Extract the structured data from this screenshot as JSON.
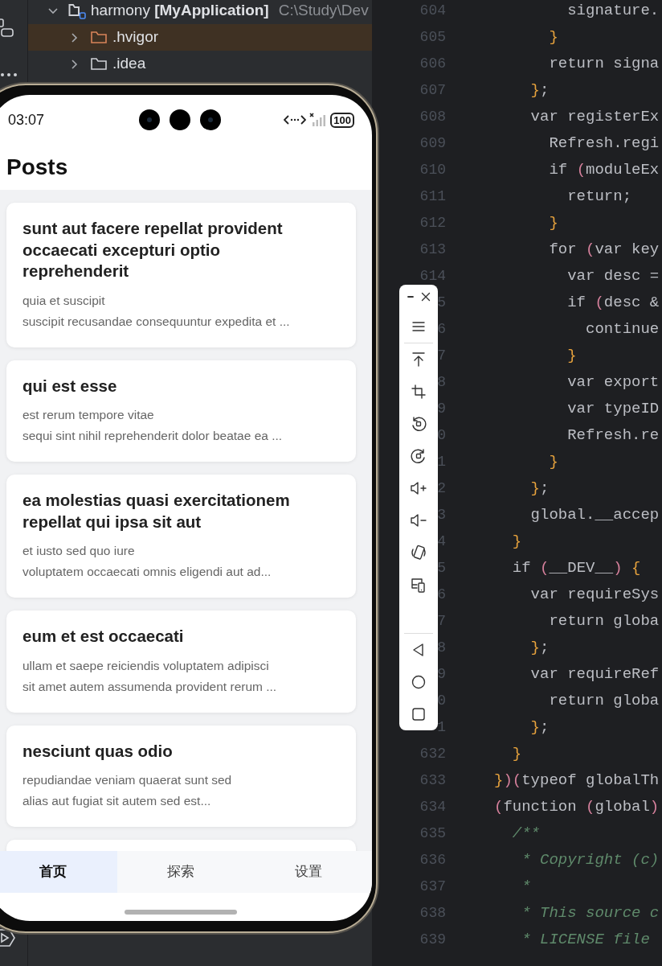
{
  "project_tree": {
    "items": [
      {
        "label": "harmony **[MyApplication]**",
        "path": "C:\\Study\\Dev",
        "expanded": true,
        "selected": false,
        "color": "#cfd1d6",
        "children": [
          {
            "label": ".hvigor",
            "expanded": false,
            "selected": true,
            "color": "#d9845a"
          },
          {
            "label": ".idea",
            "expanded": false,
            "selected": false,
            "color": "#cfd1d6"
          }
        ]
      }
    ]
  },
  "editor": {
    "lines": [
      {
        "number": "604",
        "code": "        signature.",
        "kind": "code"
      },
      {
        "number": "605",
        "code": "      }",
        "kind": "code"
      },
      {
        "number": "606",
        "code": "      return signa",
        "kind": "code"
      },
      {
        "number": "607",
        "code": "    };",
        "kind": "code"
      },
      {
        "number": "608",
        "code": "    var registerEx",
        "kind": "code"
      },
      {
        "number": "609",
        "code": "      Refresh.regi",
        "kind": "code"
      },
      {
        "number": "610",
        "code": "      if (moduleEx",
        "kind": "code"
      },
      {
        "number": "611",
        "code": "        return;",
        "kind": "code"
      },
      {
        "number": "612",
        "code": "      }",
        "kind": "code"
      },
      {
        "number": "613",
        "code": "      for (var key",
        "kind": "code"
      },
      {
        "number": "614",
        "code": "        var desc =",
        "kind": "code"
      },
      {
        "number": "5",
        "code": "        if (desc &",
        "kind": "code"
      },
      {
        "number": "6",
        "code": "          continue",
        "kind": "code"
      },
      {
        "number": "7",
        "code": "        }",
        "kind": "code"
      },
      {
        "number": "8",
        "code": "        var export",
        "kind": "code"
      },
      {
        "number": "9",
        "code": "        var typeID",
        "kind": "code"
      },
      {
        "number": "0",
        "code": "        Refresh.re",
        "kind": "code"
      },
      {
        "number": "1",
        "code": "      }",
        "kind": "code"
      },
      {
        "number": "2",
        "code": "    };",
        "kind": "code"
      },
      {
        "number": "3",
        "code": "    global.__accep",
        "kind": "code"
      },
      {
        "number": "4",
        "code": "  }",
        "kind": "code"
      },
      {
        "number": "5",
        "code": "  if (__DEV__) {",
        "kind": "code"
      },
      {
        "number": "6",
        "code": "    var requireSys",
        "kind": "code"
      },
      {
        "number": "7",
        "code": "      return globa",
        "kind": "code"
      },
      {
        "number": "8",
        "code": "    };",
        "kind": "code"
      },
      {
        "number": "9",
        "code": "    var requireRef",
        "kind": "code"
      },
      {
        "number": "0",
        "code": "      return globa",
        "kind": "code"
      },
      {
        "number": "1",
        "code": "    };",
        "kind": "code"
      },
      {
        "number": "632",
        "code": "  }",
        "kind": "code"
      },
      {
        "number": "633",
        "code": "})(typeof globalTh",
        "kind": "code"
      },
      {
        "number": "634",
        "code": "(function (global)",
        "kind": "code"
      },
      {
        "number": "635",
        "code": "  /**",
        "kind": "comment"
      },
      {
        "number": "636",
        "code": "   * Copyright (c)",
        "kind": "comment"
      },
      {
        "number": "637",
        "code": "   *",
        "kind": "comment"
      },
      {
        "number": "638",
        "code": "   * This source c",
        "kind": "comment"
      },
      {
        "number": "639",
        "code": "   * LICENSE file",
        "kind": "comment"
      }
    ]
  },
  "phone": {
    "status_bar": {
      "time": "03:07",
      "battery": "100"
    },
    "title": "Posts",
    "posts": [
      {
        "title": "sunt aut facere repellat provident occaecati excepturi optio reprehenderit",
        "body": "quia et suscipit\nsuscipit recusandae consequuntur expedita et ..."
      },
      {
        "title": "qui est esse",
        "body": "est rerum tempore vitae\nsequi sint nihil reprehenderit dolor beatae ea ..."
      },
      {
        "title": "ea molestias quasi exercitationem repellat qui ipsa sit aut",
        "body": "et iusto sed quo iure\nvoluptatem occaecati omnis eligendi aut ad..."
      },
      {
        "title": "eum et est occaecati",
        "body": "ullam et saepe reiciendis voluptatem adipisci\nsit amet autem assumenda provident rerum ..."
      },
      {
        "title": "nesciunt quas odio",
        "body": "repudiandae veniam quaerat sunt sed\nalias aut fugiat sit autem sed est..."
      }
    ],
    "more_below": true,
    "tabs": [
      {
        "label": "首页",
        "selected": true
      },
      {
        "label": "探索",
        "selected": false
      },
      {
        "label": "设置",
        "selected": false
      }
    ]
  }
}
